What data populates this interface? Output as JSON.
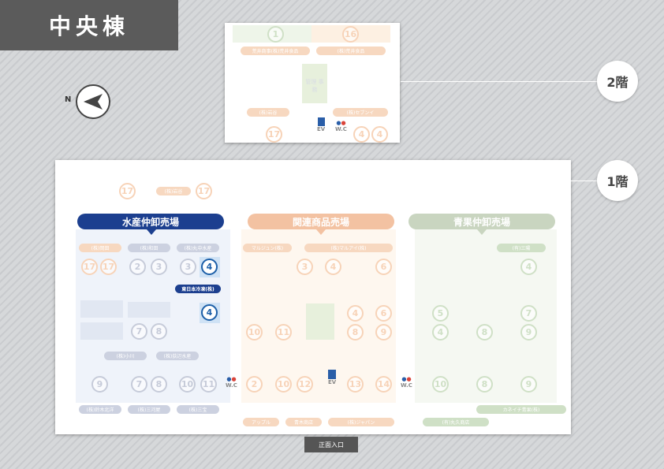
{
  "title": "中央棟",
  "north_label": "N",
  "floors": {
    "second": "2階",
    "first": "1階"
  },
  "entrance": "正面入口",
  "second_floor": {
    "numbers": [
      "1",
      "16",
      "17",
      "4",
      "4"
    ],
    "pills": [
      "荒井商事(株)荒井食品",
      "(株)荒井食品",
      "(株)岩谷",
      "(株)マル十",
      "(株)セブンイ"
    ],
    "center_label": "管理 事務",
    "ev": "EV",
    "wc": "W.C"
  },
  "zones": {
    "seafood": "水産仲卸売場",
    "related": "関連商品売場",
    "produce": "青果仲卸売場"
  },
  "seafood": {
    "top_pills": [
      "(株)岡田",
      "(株)和田",
      "(株)丸中水産"
    ],
    "row1": [
      "17",
      "17",
      "2",
      "3",
      "3",
      "4"
    ],
    "highlight_pill": "東日本冷凍(株)",
    "row2": [
      "4"
    ],
    "row3": [
      "7",
      "8"
    ],
    "mid_pills": [
      "(株)小川",
      "(株)荻辺水産"
    ],
    "row4": [
      "9",
      "7",
      "8",
      "10",
      "11"
    ],
    "bottom_pills": [
      "(株)鈴木北洋",
      "(株)三河屋",
      "(株)三宝"
    ]
  },
  "related": {
    "top_pills": [
      "マルジュン(株)",
      "(株)マルアイ(株)"
    ],
    "row1": [
      "3",
      "4",
      "6"
    ],
    "row2": [
      "4",
      "6"
    ],
    "row3": [
      "10",
      "11",
      "8",
      "9"
    ],
    "row4": [
      "2",
      "10",
      "12",
      "13",
      "14"
    ],
    "bottom_pills": [
      "アップル",
      "青木商店",
      "(株)ジャパン"
    ]
  },
  "produce": {
    "top_pills": [
      "(有)三陽"
    ],
    "row1": [
      "4"
    ],
    "row2": [
      "5",
      "7"
    ],
    "row3": [
      "4",
      "8",
      "9"
    ],
    "row4": [
      "10",
      "8",
      "9"
    ],
    "bottom_pills": [
      "(有)丸久商店",
      "カネイチ青果(株)"
    ]
  },
  "top_row": {
    "numbers": [
      "17",
      "17"
    ],
    "pill": "(株)岩谷"
  },
  "ev": "EV",
  "wc": "W.C"
}
